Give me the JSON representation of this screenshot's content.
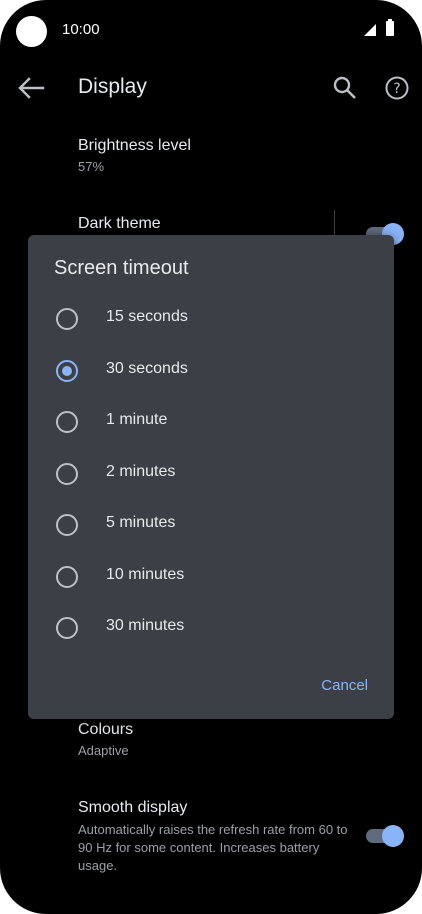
{
  "status_bar": {
    "time": "10:00",
    "signal_icon": "signal-icon",
    "battery_icon": "battery-icon"
  },
  "app_bar": {
    "title": "Display",
    "back_icon": "arrow-back-icon",
    "search_icon": "search-icon",
    "help_icon": "help-icon"
  },
  "settings": {
    "brightness": {
      "title": "Brightness level",
      "value": "57%"
    },
    "dark_theme": {
      "title": "Dark theme",
      "enabled": true
    },
    "colours": {
      "title": "Colours",
      "value": "Adaptive"
    },
    "smooth_display": {
      "title": "Smooth display",
      "description": "Automatically raises the refresh rate from 60 to 90 Hz for some content. Increases battery usage.",
      "enabled": true
    }
  },
  "dialog": {
    "title": "Screen timeout",
    "options": [
      {
        "label": "15 seconds",
        "selected": false
      },
      {
        "label": "30 seconds",
        "selected": true
      },
      {
        "label": "1 minute",
        "selected": false
      },
      {
        "label": "2 minutes",
        "selected": false
      },
      {
        "label": "5 minutes",
        "selected": false
      },
      {
        "label": "10 minutes",
        "selected": false
      },
      {
        "label": "30 minutes",
        "selected": false
      }
    ],
    "cancel_label": "Cancel"
  },
  "colors": {
    "accent": "#8ab4f8",
    "dialog_bg": "#3c3f45",
    "background": "#000000"
  }
}
